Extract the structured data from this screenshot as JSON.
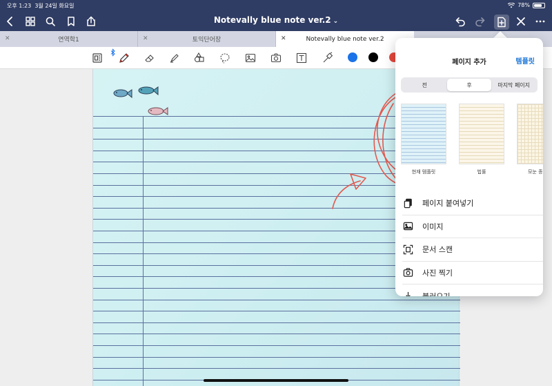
{
  "status": {
    "time": "오후 1:23",
    "date": "3월 24일 화요일",
    "battery": "78%"
  },
  "nav": {
    "title": "Notevally blue note ver.2"
  },
  "tabs": [
    {
      "label": "연역학1"
    },
    {
      "label": "토익단어장"
    },
    {
      "label": "Notevally blue note ver.2",
      "active": true
    }
  ],
  "toolbar": {
    "tools": [
      "page-view-icon",
      "bluetooth-icon",
      "pen-icon",
      "eraser-icon",
      "highlighter-icon",
      "shapes-icon",
      "lasso-icon",
      "image-icon",
      "camera-icon",
      "text-icon",
      "laser-pointer-icon"
    ],
    "colors": [
      "#1a73e8",
      "#000000",
      "#e5473b"
    ]
  },
  "popover": {
    "title": "페이지 추가",
    "template_link": "템플릿",
    "segments": [
      "전",
      "후",
      "마지막 페이지"
    ],
    "selected_segment": "후",
    "thumbnails": [
      {
        "label": "현재 템플릿"
      },
      {
        "label": "법률"
      },
      {
        "label": "모눈 종"
      }
    ],
    "menu": [
      {
        "label": "페이지 붙여넣기",
        "icon": "paste-page-icon"
      },
      {
        "label": "이미지",
        "icon": "image-icon"
      },
      {
        "label": "문서 스캔",
        "icon": "scan-document-icon"
      },
      {
        "label": "사진 찍기",
        "icon": "camera-icon"
      },
      {
        "label": "불러오기",
        "icon": "import-icon"
      }
    ]
  },
  "annotation": {
    "color": "#e4584f"
  }
}
